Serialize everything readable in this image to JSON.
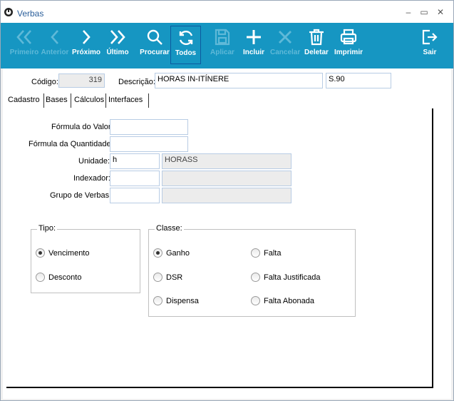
{
  "window": {
    "title": "Verbas",
    "minimize": "–",
    "maximize": "▭",
    "close": "✕"
  },
  "toolbar": [
    {
      "key": "primeiro",
      "label": "Primeiro",
      "icon": "double-chevron-left-icon",
      "enabled": false
    },
    {
      "key": "anterior",
      "label": "Anterior",
      "icon": "chevron-left-icon",
      "enabled": false
    },
    {
      "key": "proximo",
      "label": "Próximo",
      "icon": "chevron-right-icon",
      "enabled": true
    },
    {
      "key": "ultimo",
      "label": "Último",
      "icon": "double-chevron-right-icon",
      "enabled": true
    },
    {
      "key": "procurar",
      "label": "Procurar",
      "icon": "search-icon",
      "enabled": true
    },
    {
      "key": "todos",
      "label": "Todos",
      "icon": "refresh-icon",
      "enabled": true
    },
    {
      "key": "aplicar",
      "label": "Aplicar",
      "icon": "save-icon",
      "enabled": false
    },
    {
      "key": "incluir",
      "label": "Incluir",
      "icon": "plus-icon",
      "enabled": true
    },
    {
      "key": "cancelar",
      "label": "Cancelar",
      "icon": "x-icon",
      "enabled": false
    },
    {
      "key": "deletar",
      "label": "Deletar",
      "icon": "trash-icon",
      "enabled": true
    },
    {
      "key": "imprimir",
      "label": "Imprimir",
      "icon": "printer-icon",
      "enabled": true
    },
    {
      "key": "sair",
      "label": "Sair",
      "icon": "exit-icon",
      "enabled": true
    }
  ],
  "header": {
    "codigo_label": "Código:",
    "codigo_value": "319",
    "descricao_label": "Descrição:",
    "descricao_value": "HORAS IN-ITÍNERE",
    "codigo_extra_value": "S.90"
  },
  "tabs": [
    "Cadastro",
    "Bases",
    "Cálculos",
    "Interfaces"
  ],
  "form": {
    "formula_valor_label": "Fórmula do Valor:",
    "formula_valor_value": "",
    "formula_quantidade_label": "Fórmula da Quantidade:",
    "formula_quantidade_value": "",
    "unidade_label": "Unidade:",
    "unidade_value": "h",
    "unidade_desc": "HORASS",
    "indexador_label": "Indexador:",
    "indexador_value": "",
    "indexador_desc": "",
    "grupo_label": "Grupo de Verbas:",
    "grupo_value": "",
    "grupo_desc": ""
  },
  "tipo": {
    "title": "Tipo:",
    "options": [
      "Vencimento",
      "Desconto"
    ],
    "selected": "Vencimento"
  },
  "classe": {
    "title": "Classe:",
    "options": [
      "Ganho",
      "DSR",
      "Dispensa",
      "Falta",
      "Falta Justificada",
      "Falta Abonada"
    ],
    "selected": "Ganho"
  },
  "colors": {
    "toolbar_bg": "#1696c2",
    "title_text": "#2a5e9a",
    "field_border": "#b8cce4"
  }
}
